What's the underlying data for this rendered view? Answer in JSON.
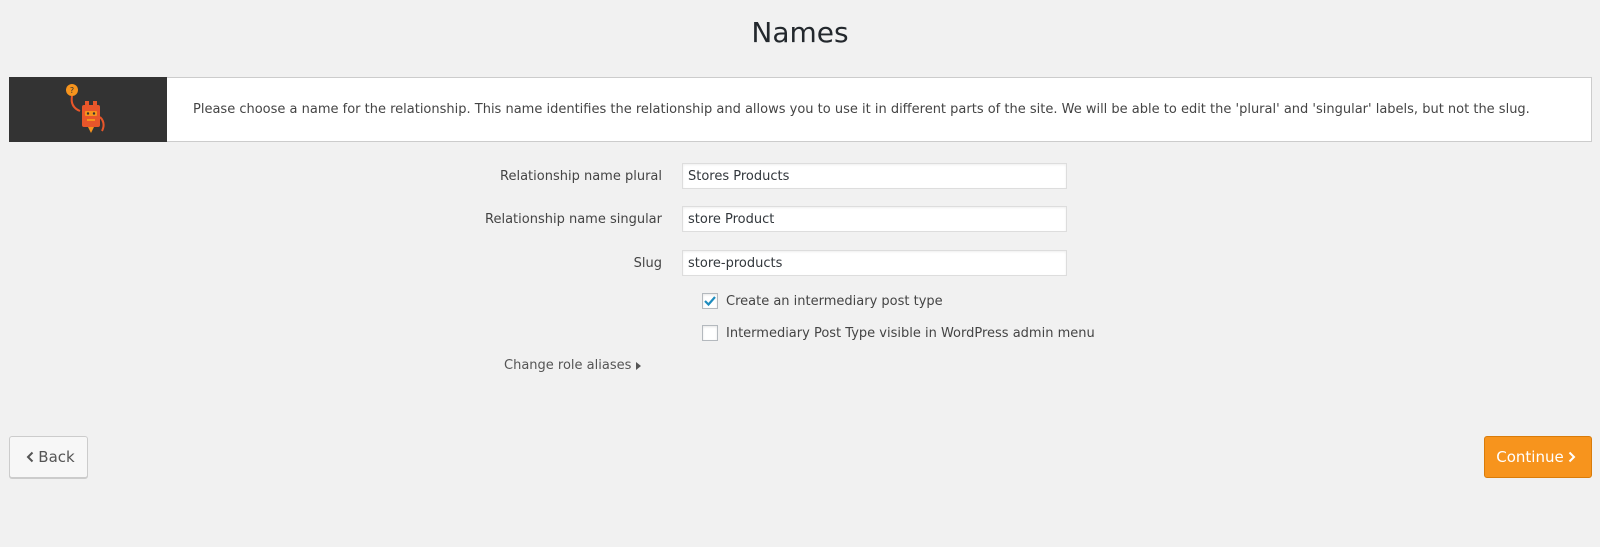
{
  "page": {
    "title": "Names"
  },
  "notice": {
    "logo_icon": "toolset-robot-icon",
    "text": "Please choose a name for the relationship. This name identifies the relationship and allows you to use it in different parts of the site. We will be able to edit the 'plural' and 'singular' labels, but not the slug."
  },
  "form": {
    "plural_label": "Relationship name plural",
    "plural_value": "Stores Products",
    "singular_label": "Relationship name singular",
    "singular_value": "store Product",
    "slug_label": "Slug",
    "slug_value": "store-products",
    "intermediary_label": "Create an intermediary post type",
    "intermediary_checked": true,
    "visible_label": "Intermediary Post Type visible in WordPress admin menu",
    "visible_checked": false,
    "aliases_label": "Change role aliases"
  },
  "buttons": {
    "back_label": "Back",
    "continue_label": "Continue"
  },
  "colors": {
    "accent": "#f7941d",
    "logo_bg": "#333333",
    "checkmark": "#1e8cbe"
  }
}
